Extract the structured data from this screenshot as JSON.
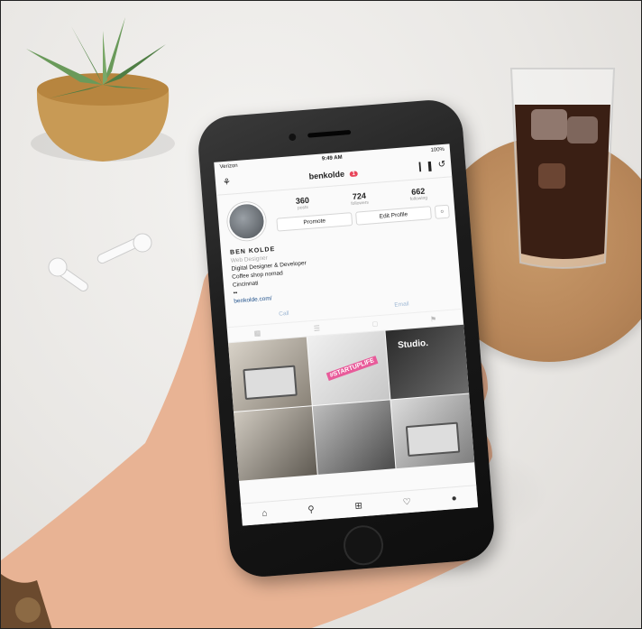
{
  "status_bar": {
    "carrier": "Verizon",
    "time": "9:49 AM",
    "battery": "100%"
  },
  "header": {
    "username": "benkolde",
    "notification_badge": "1"
  },
  "profile": {
    "stats": [
      {
        "value": "360",
        "label": "posts"
      },
      {
        "value": "724",
        "label": "followers"
      },
      {
        "value": "662",
        "label": "following"
      }
    ],
    "promote_label": "Promote",
    "edit_profile_label": "Edit Profile"
  },
  "bio": {
    "name": "BEN KOLDE",
    "role": "Web Designer",
    "lines": [
      "Digital Designer & Developer",
      "Coffee shop nomad",
      "Cincinnati",
      "••"
    ],
    "link": "benkolde.com/"
  },
  "actions": {
    "call_label": "Call",
    "email_label": "Email"
  },
  "grid": {
    "startup_text": "#STARTUPLIFE",
    "studio_text": "Studio."
  },
  "icons": {
    "add_user": "add-user-icon",
    "insights": "insights-icon",
    "history": "history-icon",
    "home": "home-icon",
    "search": "search-icon",
    "add": "add-post-icon",
    "heart": "heart-icon",
    "profile": "profile-icon"
  },
  "colors": {
    "badge": "#e8455a",
    "link": "#1d4f8a",
    "action_text": "#9fb8d4"
  }
}
